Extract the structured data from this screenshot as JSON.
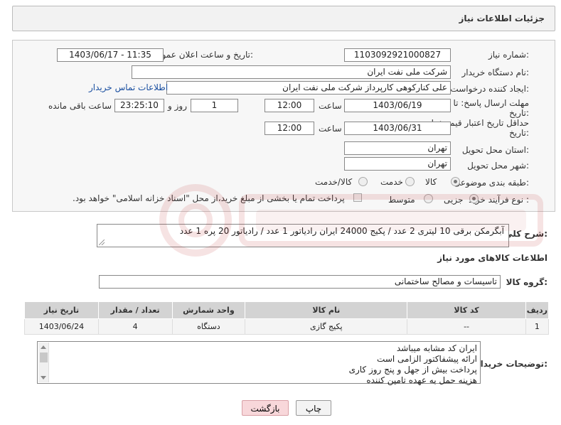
{
  "header": {
    "title": "جزئیات اطلاعات نیاز"
  },
  "fields": {
    "need_number_label": "شماره نیاز:",
    "need_number": "1103092921000827",
    "announce_label": "تاریخ و ساعت اعلان عمومی:",
    "announce_value": "1403/06/17 - 11:35",
    "buyer_org_label": "نام دستگاه خریدار:",
    "buyer_org": "شرکت ملی نفت ایران",
    "creator_label": "ایجاد کننده درخواست:",
    "creator": "علی کنارکوهی کارپرداز شرکت ملی نفت ایران",
    "contact_link": "اطلاعات تماس خریدار",
    "deadline_label_1": "مهلت ارسال پاسخ: تا",
    "deadline_label_2": "تاریخ:",
    "deadline_date": "1403/06/19",
    "time_label": "ساعت",
    "deadline_time": "12:00",
    "days_value": "1",
    "days_label": "روز و",
    "remaining_time": "23:25:10",
    "remaining_label": "ساعت باقی مانده",
    "validity_label_1": "حداقل تاریخ اعتبار قیمت: تا",
    "validity_label_2": "تاریخ:",
    "validity_date": "1403/06/31",
    "validity_time": "12:00",
    "province_label": "استان محل تحویل:",
    "province": "تهران",
    "city_label": "شهر محل تحویل:",
    "city": "تهران",
    "category_label": "طبقه بندی موضوعی:",
    "category_options": [
      "کالا",
      "خدمت",
      "کالا/خدمت"
    ],
    "process_label": "نوع فرآیند خرید :",
    "process_options": [
      "جزیی",
      "متوسط"
    ],
    "payment_note": "پرداخت تمام یا بخشی از مبلغ خرید،از محل \"اسناد خزانه اسلامی\" خواهد بود."
  },
  "description": {
    "label": "شرح کلی نیاز:",
    "text": "آبگرمکن برقی 10 لیتری 2 عدد / پکیج 24000 ایران رادیاتور 1 عدد / رادیاتور 20 پره 1 عدد"
  },
  "goods_info_title": "اطلاعات کالاهای مورد نیاز",
  "goods_group": {
    "label": "گروه کالا:",
    "value": "تاسیسات و مصالح ساختمانی"
  },
  "table": {
    "headers": [
      "ردیف",
      "کد کالا",
      "نام کالا",
      "واحد شمارش",
      "تعداد / مقدار",
      "تاریخ نیاز"
    ],
    "rows": [
      [
        "1",
        "--",
        "پکیج گازی",
        "دستگاه",
        "4",
        "1403/06/24"
      ]
    ]
  },
  "notes": {
    "label": "توضیحات خریدار:",
    "lines": [
      "ایران کد مشابه میباشد",
      "ارائه پیشفاکتور الزامی است",
      "پرداخت بیش از جهل و پنج روز کاری",
      "هزینه حمل به عهده تامین کننده"
    ]
  },
  "buttons": {
    "print": "چاپ",
    "back": "بازگشت"
  },
  "colors": {
    "back_button_bg": "#f8d7da",
    "print_button_bg": "#f3f3f3",
    "link": "#1a4fa0"
  }
}
